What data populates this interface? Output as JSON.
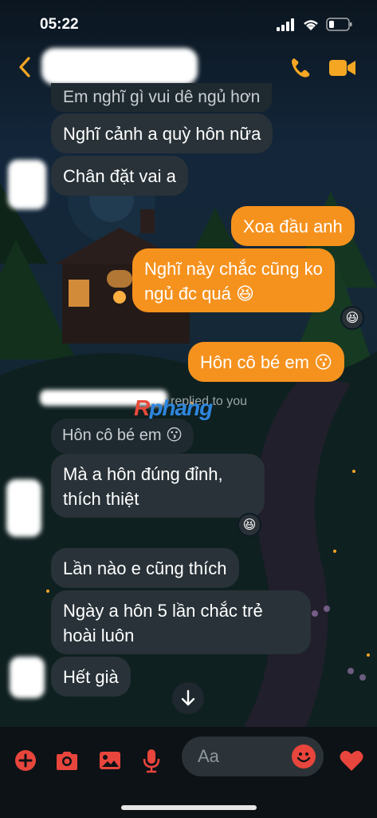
{
  "status_bar": {
    "time": "05:22"
  },
  "header": {
    "contact_name": ""
  },
  "messages": [
    {
      "text": "Em nghĩ gì vui dê ngủ hơn"
    },
    {
      "text": "Nghĩ cảnh a quỳ hôn nữa"
    },
    {
      "text": "Chân đặt vai a"
    },
    {
      "text": "Xoa đầu anh"
    },
    {
      "line1": "Nghĩ này chắc cũng ko",
      "line2": "ngủ đc quá 😆"
    },
    {
      "text": "Hôn cô bé em 😗"
    },
    {
      "text": "Hôn cô bé em 😗"
    },
    {
      "line1": "Mà a hôn đúng đỉnh,",
      "line2": "thích thiệt"
    },
    {
      "text": "Lần nào e cũng thích"
    },
    {
      "line1": "Ngày a hôn 5 lần chắc trẻ",
      "line2": "hoài luôn"
    },
    {
      "text": "Hết già"
    }
  ],
  "reactions": {
    "r1": "😆",
    "r2": "😆"
  },
  "reply_indicator": {
    "label": "replied to you"
  },
  "watermark": {
    "part1": "R",
    "part2": "phang"
  },
  "composer": {
    "placeholder": "Aa"
  },
  "colors": {
    "outgoing": "#f5921e",
    "incoming": "#283238",
    "accent": "#e8453c"
  },
  "icons": [
    "back-arrow-icon",
    "phone-icon",
    "video-camera-icon",
    "plus-circle-icon",
    "camera-icon",
    "image-icon",
    "microphone-icon",
    "emoji-icon",
    "heart-icon",
    "arrow-down-icon"
  ]
}
